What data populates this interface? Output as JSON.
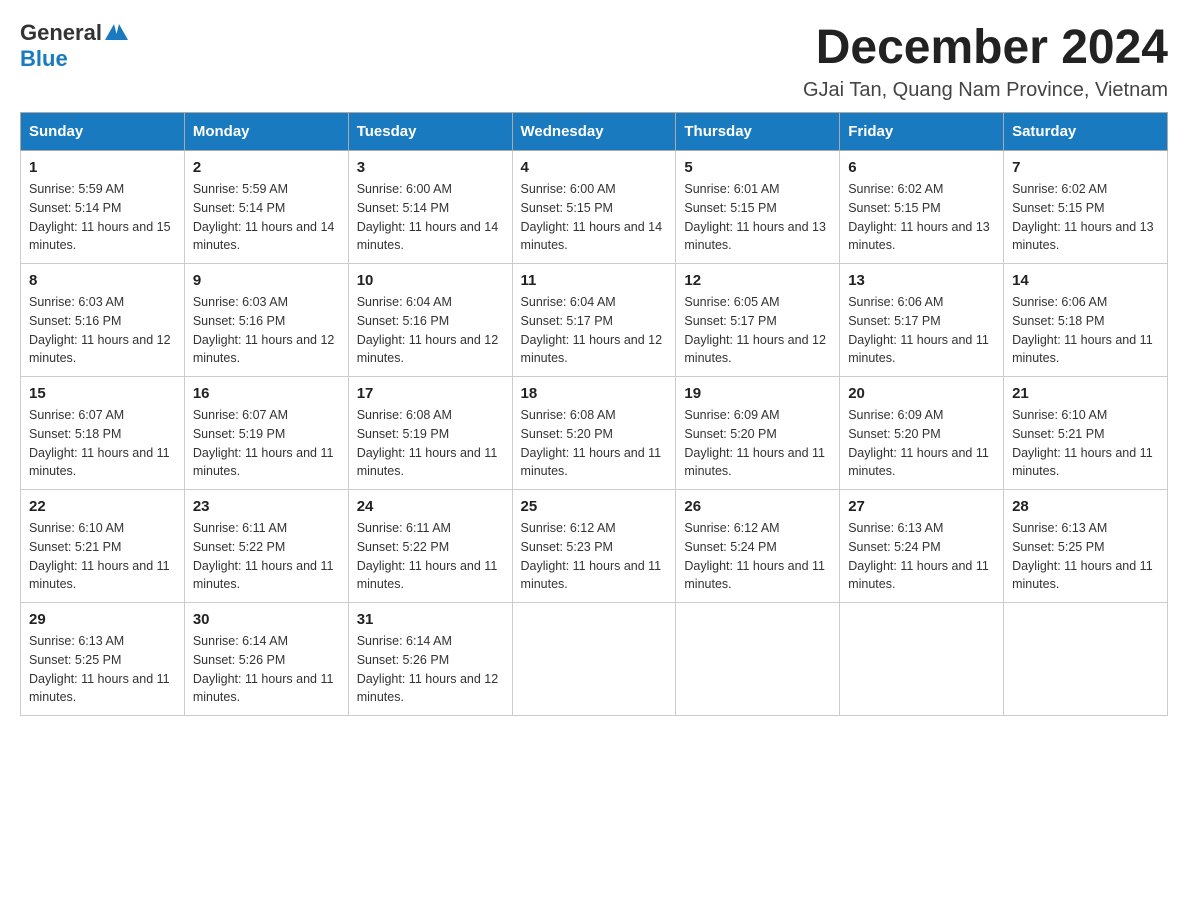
{
  "header": {
    "logo_general": "General",
    "logo_blue": "Blue",
    "title": "December 2024",
    "subtitle": "GJai Tan, Quang Nam Province, Vietnam"
  },
  "calendar": {
    "days_of_week": [
      "Sunday",
      "Monday",
      "Tuesday",
      "Wednesday",
      "Thursday",
      "Friday",
      "Saturday"
    ],
    "weeks": [
      [
        {
          "day": "1",
          "sunrise": "Sunrise: 5:59 AM",
          "sunset": "Sunset: 5:14 PM",
          "daylight": "Daylight: 11 hours and 15 minutes."
        },
        {
          "day": "2",
          "sunrise": "Sunrise: 5:59 AM",
          "sunset": "Sunset: 5:14 PM",
          "daylight": "Daylight: 11 hours and 14 minutes."
        },
        {
          "day": "3",
          "sunrise": "Sunrise: 6:00 AM",
          "sunset": "Sunset: 5:14 PM",
          "daylight": "Daylight: 11 hours and 14 minutes."
        },
        {
          "day": "4",
          "sunrise": "Sunrise: 6:00 AM",
          "sunset": "Sunset: 5:15 PM",
          "daylight": "Daylight: 11 hours and 14 minutes."
        },
        {
          "day": "5",
          "sunrise": "Sunrise: 6:01 AM",
          "sunset": "Sunset: 5:15 PM",
          "daylight": "Daylight: 11 hours and 13 minutes."
        },
        {
          "day": "6",
          "sunrise": "Sunrise: 6:02 AM",
          "sunset": "Sunset: 5:15 PM",
          "daylight": "Daylight: 11 hours and 13 minutes."
        },
        {
          "day": "7",
          "sunrise": "Sunrise: 6:02 AM",
          "sunset": "Sunset: 5:15 PM",
          "daylight": "Daylight: 11 hours and 13 minutes."
        }
      ],
      [
        {
          "day": "8",
          "sunrise": "Sunrise: 6:03 AM",
          "sunset": "Sunset: 5:16 PM",
          "daylight": "Daylight: 11 hours and 12 minutes."
        },
        {
          "day": "9",
          "sunrise": "Sunrise: 6:03 AM",
          "sunset": "Sunset: 5:16 PM",
          "daylight": "Daylight: 11 hours and 12 minutes."
        },
        {
          "day": "10",
          "sunrise": "Sunrise: 6:04 AM",
          "sunset": "Sunset: 5:16 PM",
          "daylight": "Daylight: 11 hours and 12 minutes."
        },
        {
          "day": "11",
          "sunrise": "Sunrise: 6:04 AM",
          "sunset": "Sunset: 5:17 PM",
          "daylight": "Daylight: 11 hours and 12 minutes."
        },
        {
          "day": "12",
          "sunrise": "Sunrise: 6:05 AM",
          "sunset": "Sunset: 5:17 PM",
          "daylight": "Daylight: 11 hours and 12 minutes."
        },
        {
          "day": "13",
          "sunrise": "Sunrise: 6:06 AM",
          "sunset": "Sunset: 5:17 PM",
          "daylight": "Daylight: 11 hours and 11 minutes."
        },
        {
          "day": "14",
          "sunrise": "Sunrise: 6:06 AM",
          "sunset": "Sunset: 5:18 PM",
          "daylight": "Daylight: 11 hours and 11 minutes."
        }
      ],
      [
        {
          "day": "15",
          "sunrise": "Sunrise: 6:07 AM",
          "sunset": "Sunset: 5:18 PM",
          "daylight": "Daylight: 11 hours and 11 minutes."
        },
        {
          "day": "16",
          "sunrise": "Sunrise: 6:07 AM",
          "sunset": "Sunset: 5:19 PM",
          "daylight": "Daylight: 11 hours and 11 minutes."
        },
        {
          "day": "17",
          "sunrise": "Sunrise: 6:08 AM",
          "sunset": "Sunset: 5:19 PM",
          "daylight": "Daylight: 11 hours and 11 minutes."
        },
        {
          "day": "18",
          "sunrise": "Sunrise: 6:08 AM",
          "sunset": "Sunset: 5:20 PM",
          "daylight": "Daylight: 11 hours and 11 minutes."
        },
        {
          "day": "19",
          "sunrise": "Sunrise: 6:09 AM",
          "sunset": "Sunset: 5:20 PM",
          "daylight": "Daylight: 11 hours and 11 minutes."
        },
        {
          "day": "20",
          "sunrise": "Sunrise: 6:09 AM",
          "sunset": "Sunset: 5:20 PM",
          "daylight": "Daylight: 11 hours and 11 minutes."
        },
        {
          "day": "21",
          "sunrise": "Sunrise: 6:10 AM",
          "sunset": "Sunset: 5:21 PM",
          "daylight": "Daylight: 11 hours and 11 minutes."
        }
      ],
      [
        {
          "day": "22",
          "sunrise": "Sunrise: 6:10 AM",
          "sunset": "Sunset: 5:21 PM",
          "daylight": "Daylight: 11 hours and 11 minutes."
        },
        {
          "day": "23",
          "sunrise": "Sunrise: 6:11 AM",
          "sunset": "Sunset: 5:22 PM",
          "daylight": "Daylight: 11 hours and 11 minutes."
        },
        {
          "day": "24",
          "sunrise": "Sunrise: 6:11 AM",
          "sunset": "Sunset: 5:22 PM",
          "daylight": "Daylight: 11 hours and 11 minutes."
        },
        {
          "day": "25",
          "sunrise": "Sunrise: 6:12 AM",
          "sunset": "Sunset: 5:23 PM",
          "daylight": "Daylight: 11 hours and 11 minutes."
        },
        {
          "day": "26",
          "sunrise": "Sunrise: 6:12 AM",
          "sunset": "Sunset: 5:24 PM",
          "daylight": "Daylight: 11 hours and 11 minutes."
        },
        {
          "day": "27",
          "sunrise": "Sunrise: 6:13 AM",
          "sunset": "Sunset: 5:24 PM",
          "daylight": "Daylight: 11 hours and 11 minutes."
        },
        {
          "day": "28",
          "sunrise": "Sunrise: 6:13 AM",
          "sunset": "Sunset: 5:25 PM",
          "daylight": "Daylight: 11 hours and 11 minutes."
        }
      ],
      [
        {
          "day": "29",
          "sunrise": "Sunrise: 6:13 AM",
          "sunset": "Sunset: 5:25 PM",
          "daylight": "Daylight: 11 hours and 11 minutes."
        },
        {
          "day": "30",
          "sunrise": "Sunrise: 6:14 AM",
          "sunset": "Sunset: 5:26 PM",
          "daylight": "Daylight: 11 hours and 11 minutes."
        },
        {
          "day": "31",
          "sunrise": "Sunrise: 6:14 AM",
          "sunset": "Sunset: 5:26 PM",
          "daylight": "Daylight: 11 hours and 12 minutes."
        },
        {
          "day": "",
          "sunrise": "",
          "sunset": "",
          "daylight": ""
        },
        {
          "day": "",
          "sunrise": "",
          "sunset": "",
          "daylight": ""
        },
        {
          "day": "",
          "sunrise": "",
          "sunset": "",
          "daylight": ""
        },
        {
          "day": "",
          "sunrise": "",
          "sunset": "",
          "daylight": ""
        }
      ]
    ]
  }
}
